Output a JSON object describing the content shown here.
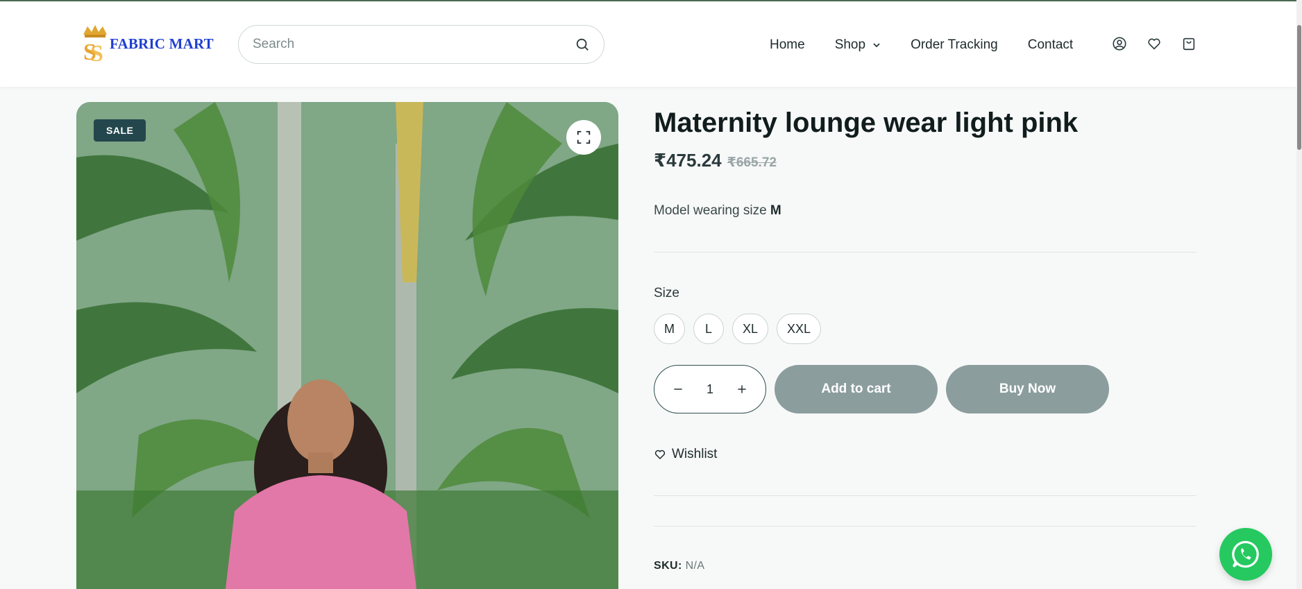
{
  "header": {
    "logo_text": "FABRIC MART",
    "search_placeholder": "Search",
    "nav": [
      {
        "label": "Home"
      },
      {
        "label": "Shop"
      },
      {
        "label": "Order Tracking"
      },
      {
        "label": "Contact"
      }
    ],
    "icons": [
      "user-icon",
      "heart-icon",
      "bag-icon"
    ]
  },
  "gallery": {
    "badge": "SALE",
    "zoom_icon": "expand-icon"
  },
  "product": {
    "title": "Maternity lounge wear light pink",
    "price": "₹475.24",
    "old_price": "₹665.72",
    "desc_prefix": "Model wearing size ",
    "desc_size": "M",
    "size_label": "Size",
    "sizes": [
      "M",
      "L",
      "XL",
      "XXL"
    ],
    "quantity": "1",
    "add_to_cart": "Add to cart",
    "buy_now": "Buy Now",
    "wishlist": "Wishlist",
    "sku_label": "SKU:",
    "sku_value": "N/A"
  },
  "colors": {
    "accent": "#23474c",
    "button_disabled": "#8c9d9e",
    "whatsapp": "#25c95f",
    "logo_blue": "#1f3fd1",
    "logo_gold": "#e0a630"
  }
}
